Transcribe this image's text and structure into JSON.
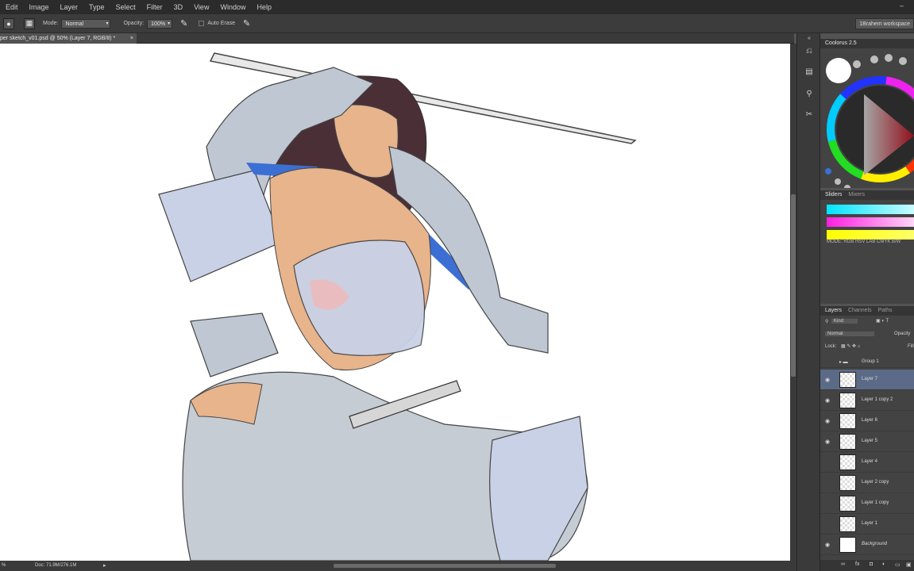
{
  "menu": {
    "items": [
      "Edit",
      "Image",
      "Layer",
      "Type",
      "Select",
      "Filter",
      "3D",
      "View",
      "Window",
      "Help"
    ],
    "minimize": "–"
  },
  "options": {
    "mode_label": "Mode:",
    "mode_value": "Normal",
    "opacity_label": "Opacity:",
    "opacity_value": "100%",
    "auto_erase_label": "Auto Erase",
    "workspace": "1Brahem workspace"
  },
  "document": {
    "tab_title": "per sketch_v01.psd @ 50% (Layer 7, RGB/8) *",
    "close": "×"
  },
  "status": {
    "zoom": "%",
    "doc": "Doc: 71.9M/276.1M"
  },
  "coolorus": {
    "title": "Coolorus 2.5"
  },
  "sliders_panel": {
    "tabs": [
      "Sliders",
      "Mixers"
    ],
    "mode_text": "MODE: RGB HSV LAB CMYK B/W",
    "colors": [
      "#00e5ff",
      "#ff1ee0",
      "#ffff00"
    ]
  },
  "layers_panel": {
    "tabs": [
      "Layers",
      "Channels",
      "Paths"
    ],
    "kind_label": "Kind",
    "blend_mode": "Normal",
    "opacity_label": "Opacity",
    "lock_label": "Lock:",
    "fill_label": "Fill",
    "layers": [
      {
        "name": "Group 1",
        "type": "group",
        "visible": false,
        "selected": false
      },
      {
        "name": "Layer 7",
        "type": "layer",
        "visible": true,
        "selected": true
      },
      {
        "name": "Layer 1 copy 2",
        "type": "layer",
        "visible": true,
        "selected": false
      },
      {
        "name": "Layer 6",
        "type": "layer",
        "visible": true,
        "selected": false
      },
      {
        "name": "Layer 5",
        "type": "layer",
        "visible": true,
        "selected": false
      },
      {
        "name": "Layer 4",
        "type": "layer",
        "visible": false,
        "selected": false
      },
      {
        "name": "Layer 2 copy",
        "type": "layer",
        "visible": false,
        "selected": false
      },
      {
        "name": "Layer 1 copy",
        "type": "layer",
        "visible": false,
        "selected": false
      },
      {
        "name": "Layer 1",
        "type": "layer",
        "visible": false,
        "selected": false
      },
      {
        "name": "Background",
        "type": "background",
        "visible": true,
        "selected": false
      }
    ],
    "footer_icons": [
      "link-icon",
      "fx-icon",
      "mask-icon",
      "adjustment-icon",
      "folder-icon",
      "new-layer-icon"
    ]
  }
}
